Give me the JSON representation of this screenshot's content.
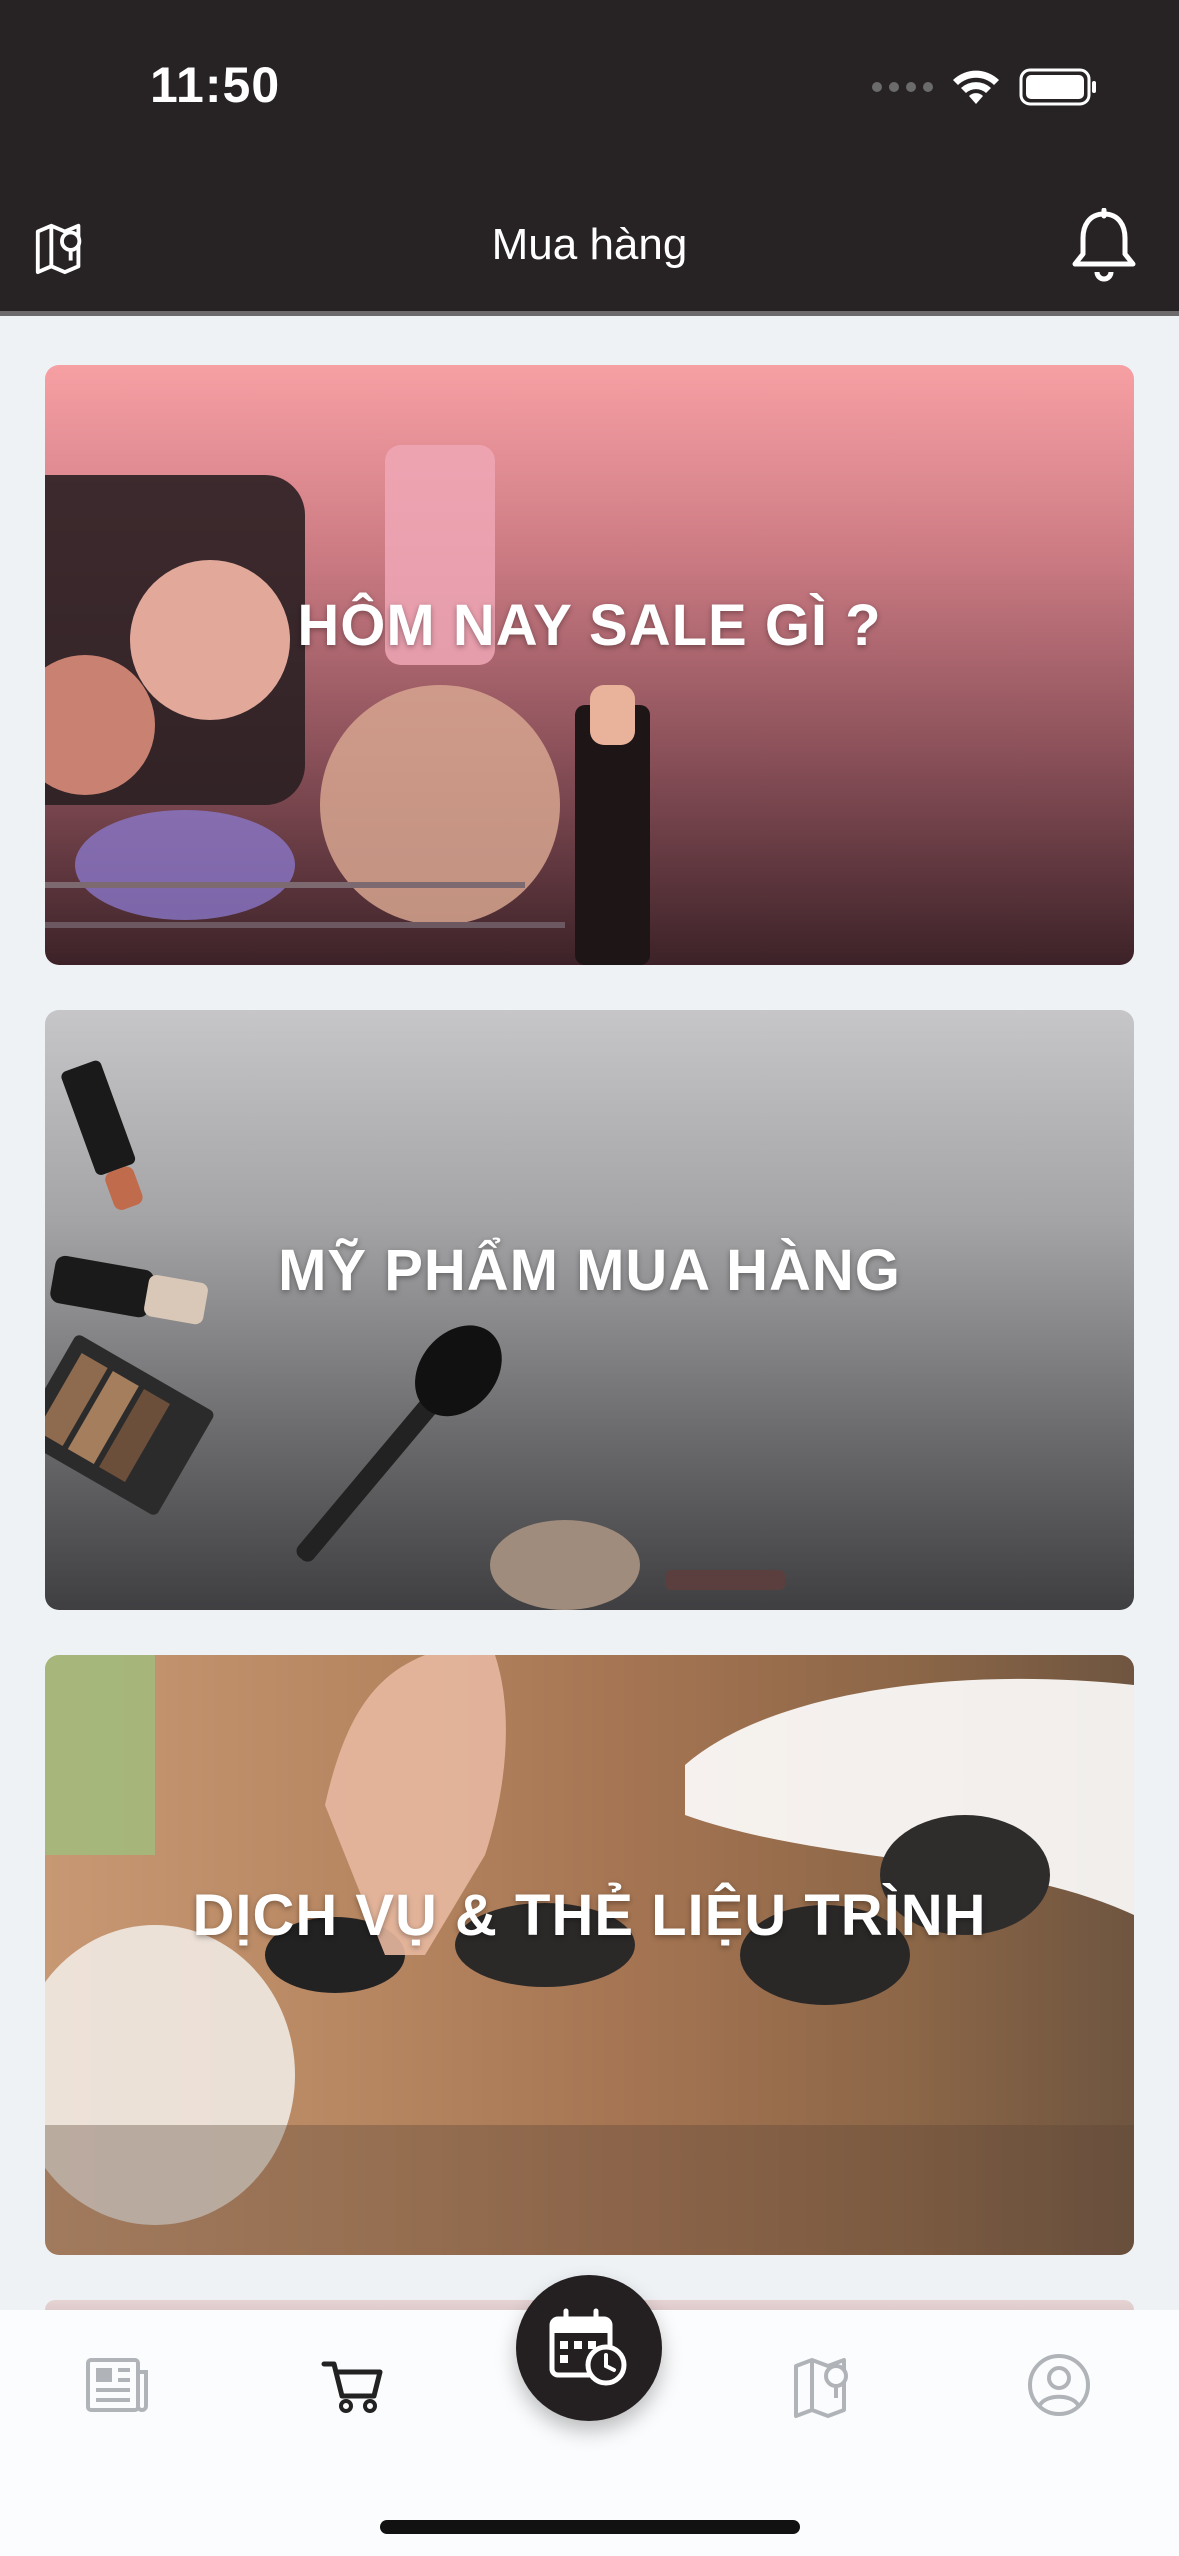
{
  "status_bar": {
    "time": "11:50"
  },
  "header": {
    "title": "Mua hàng",
    "left_icon": "map-pin-icon",
    "right_icon": "bell-icon",
    "background": "#272324"
  },
  "cards": [
    {
      "label": "HÔM NAY SALE GÌ ?",
      "accent": "#f7a0a4"
    },
    {
      "label": "MỸ PHẨM MUA HÀNG",
      "accent": "#c6c6c8"
    },
    {
      "label": "DỊCH VỤ & THẺ LIỆU TRÌNH",
      "accent": "#c79873"
    }
  ],
  "tabbar": {
    "items": [
      {
        "icon": "news-icon",
        "active": false
      },
      {
        "icon": "cart-icon",
        "active": true
      },
      {
        "icon": "calendar-clock-icon",
        "active": false
      },
      {
        "icon": "map-pin-icon",
        "active": false
      },
      {
        "icon": "profile-icon",
        "active": false
      }
    ],
    "active_color": "#222222",
    "inactive_color": "#b0b4b8"
  }
}
